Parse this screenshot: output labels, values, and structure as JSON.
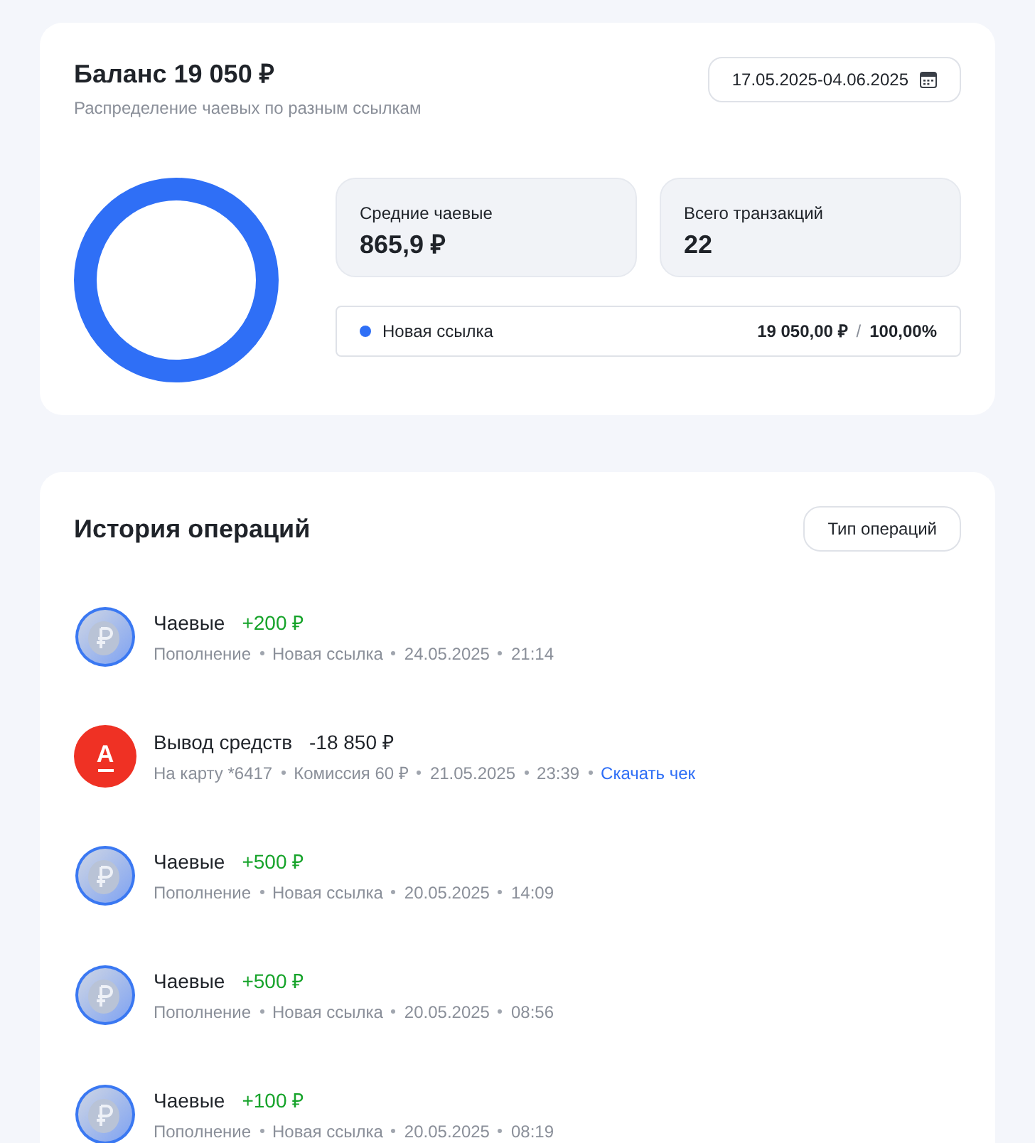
{
  "balance": {
    "title": "Баланс 19 050 ₽",
    "subtitle": "Распределение чаевых по разным ссылкам",
    "date_range": "17.05.2025-04.06.2025",
    "stats": [
      {
        "label": "Средние чаевые",
        "value": "865,9 ₽"
      },
      {
        "label": "Всего транзакций",
        "value": "22"
      }
    ],
    "legend": [
      {
        "name": "Новая ссылка",
        "color": "#2f6ff6",
        "amount": "19 050,00 ₽",
        "separator": "/",
        "share": "100,00%"
      }
    ]
  },
  "history": {
    "title": "История операций",
    "filter_button": "Тип операций",
    "operations": [
      {
        "kind": "tip",
        "title": "Чаевые",
        "amount": "+200 ₽",
        "meta": [
          "Пополнение",
          "Новая ссылка",
          "24.05.2025",
          "21:14"
        ]
      },
      {
        "kind": "withdrawal",
        "title": "Вывод средств",
        "amount": "-18 850 ₽",
        "icon_letter": "А",
        "meta": [
          "На карту *6417",
          "Комиссия 60 ₽",
          "21.05.2025",
          "23:39"
        ],
        "link": "Скачать чек"
      },
      {
        "kind": "tip",
        "title": "Чаевые",
        "amount": "+500 ₽",
        "meta": [
          "Пополнение",
          "Новая ссылка",
          "20.05.2025",
          "14:09"
        ]
      },
      {
        "kind": "tip",
        "title": "Чаевые",
        "amount": "+500 ₽",
        "meta": [
          "Пополнение",
          "Новая ссылка",
          "20.05.2025",
          "08:56"
        ]
      },
      {
        "kind": "tip",
        "title": "Чаевые",
        "amount": "+100 ₽",
        "meta": [
          "Пополнение",
          "Новая ссылка",
          "20.05.2025",
          "08:19"
        ]
      }
    ]
  }
}
